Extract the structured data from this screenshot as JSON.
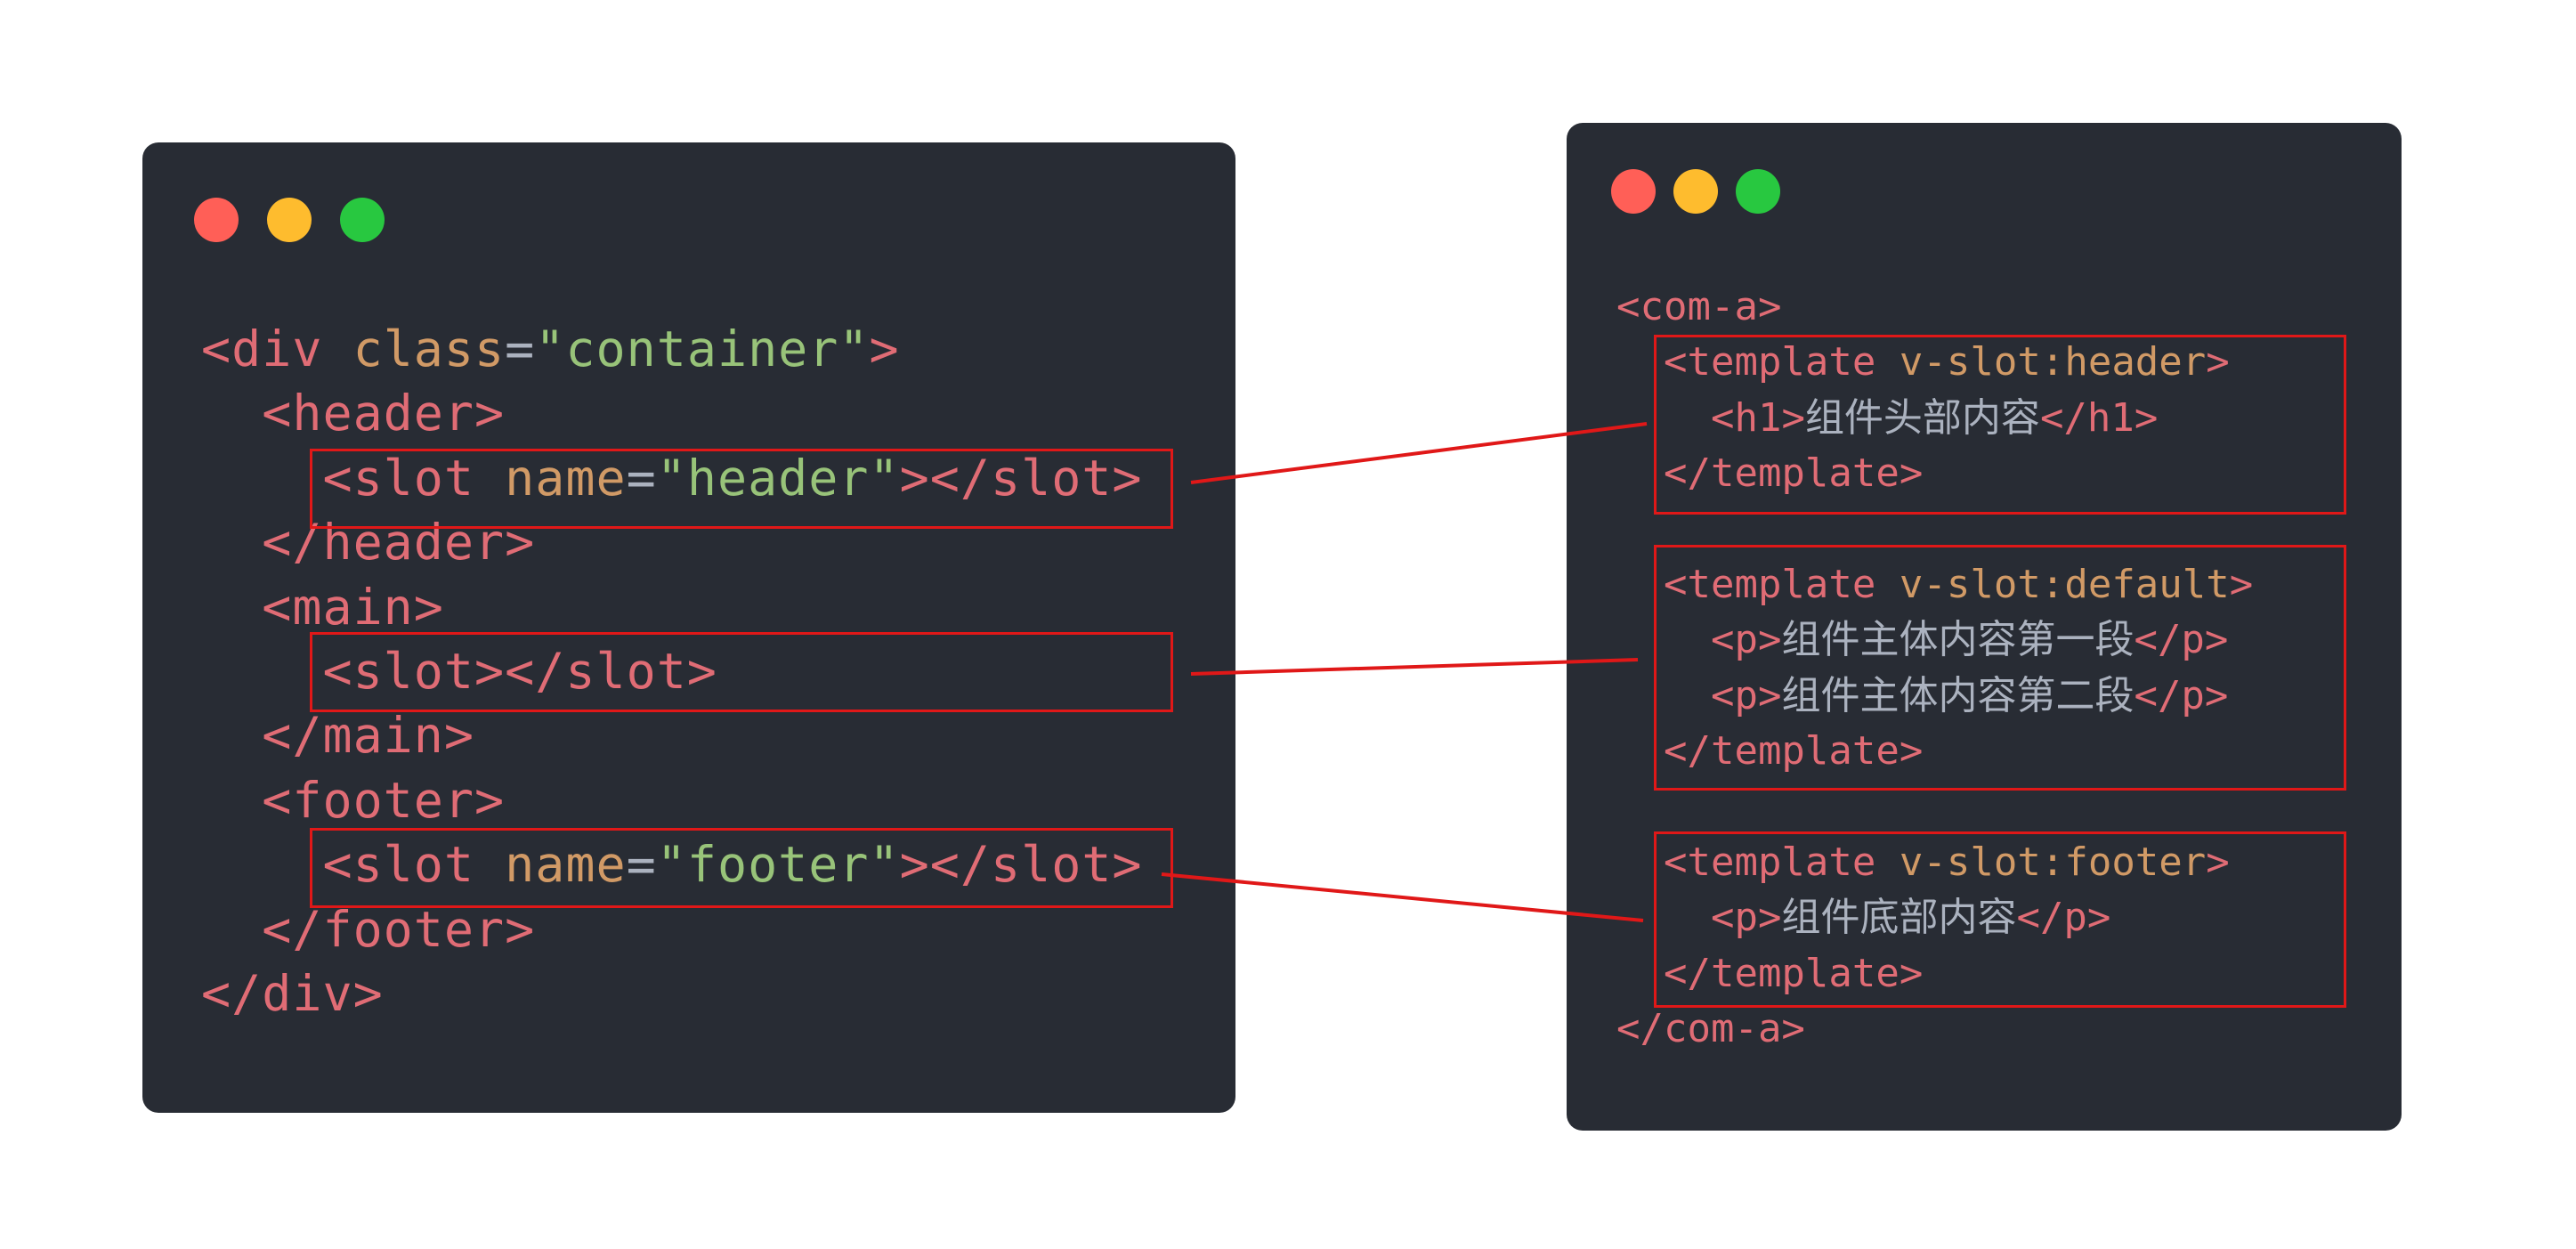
{
  "colors": {
    "panel_bg": "#282c34",
    "dot_red": "#ff5f57",
    "dot_yellow": "#febc2e",
    "dot_green": "#28c840",
    "tag": "#e06c75",
    "attribute": "#d19a66",
    "string": "#98c379",
    "text": "#abb2bf",
    "highlight": "#e01818"
  },
  "left_code": {
    "div_open": "<div",
    "div_class_attr": "class",
    "div_eq": "=",
    "div_class_value": "\"container\"",
    "div_close_bracket": ">",
    "header_open": "<header>",
    "slot_header_open": "<slot",
    "slot_header_attr": "name",
    "slot_header_eq": "=",
    "slot_header_value": "\"header\"",
    "slot_header_end": "></slot>",
    "header_close": "</header>",
    "main_open": "<main>",
    "slot_default": "<slot></slot>",
    "main_close": "</main>",
    "footer_open": "<footer>",
    "slot_footer_open": "<slot",
    "slot_footer_attr": "name",
    "slot_footer_eq": "=",
    "slot_footer_value": "\"footer\"",
    "slot_footer_end": "></slot>",
    "footer_close": "</footer>",
    "div_close": "</div>"
  },
  "right_code": {
    "coma_open": "<com-a>",
    "tpl_header_open": "<template",
    "tpl_header_directive": "v-slot:header",
    "tpl_header_bracket": ">",
    "h1_open": "<h1>",
    "h1_text": "组件头部内容",
    "h1_close": "</h1>",
    "tpl_header_close": "</template>",
    "tpl_default_open": "<template",
    "tpl_default_directive": "v-slot:default",
    "tpl_default_bracket": ">",
    "p1_open": "<p>",
    "p1_text": "组件主体内容第一段",
    "p1_close": "</p>",
    "p2_open": "<p>",
    "p2_text": "组件主体内容第二段",
    "p2_close": "</p>",
    "tpl_default_close": "</template>",
    "tpl_footer_open": "<template",
    "tpl_footer_directive": "v-slot:footer",
    "tpl_footer_bracket": ">",
    "p3_open": "<p>",
    "p3_text": "组件底部内容",
    "p3_close": "</p>",
    "tpl_footer_close": "</template>",
    "coma_close": "</com-a>"
  }
}
